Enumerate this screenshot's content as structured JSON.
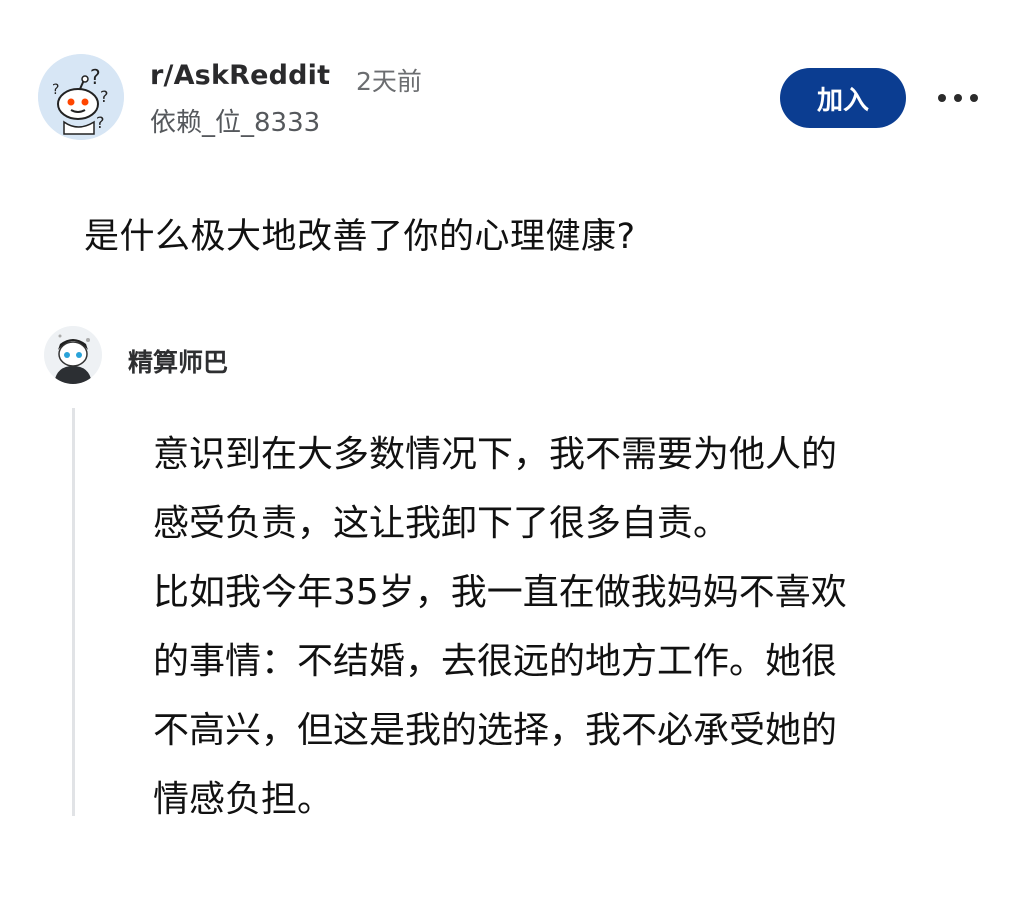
{
  "post": {
    "subreddit": "r/AskReddit",
    "time": "2天前",
    "author": "依赖_位_8333",
    "join_label": "加入",
    "more_icon": "more-horizontal-icon",
    "title": "是什么极大地改善了你的心理健康?"
  },
  "comment": {
    "author": "精算师巴",
    "lines": [
      "意识到在大多数情况下，我不需要为他人的",
      "感受负责，这让我卸下了很多自责。",
      "比如我今年35岁，我一直在做我妈妈不喜欢",
      "的事情：不结婚，去很远的地方工作。她很",
      "不高兴，但这是我的选择，我不必承受她的",
      "情感负担。"
    ]
  },
  "colors": {
    "join_button": "#0b3d91",
    "thread_line": "#e1e3e6",
    "text_primary": "#111111",
    "text_secondary": "#6b6d70"
  }
}
